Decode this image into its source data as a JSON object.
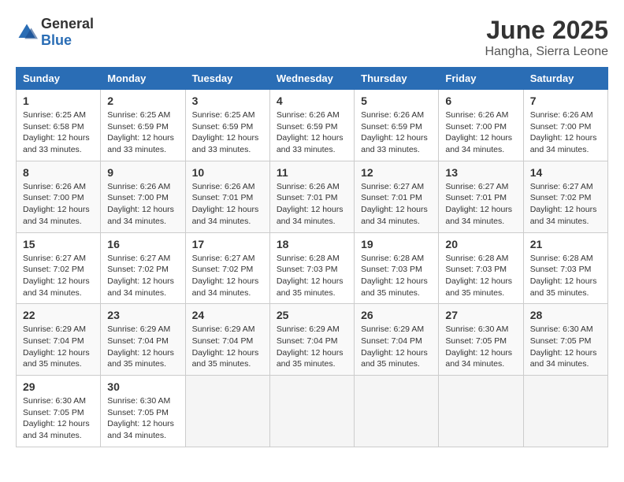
{
  "logo": {
    "general": "General",
    "blue": "Blue"
  },
  "title": "June 2025",
  "location": "Hangha, Sierra Leone",
  "days_of_week": [
    "Sunday",
    "Monday",
    "Tuesday",
    "Wednesday",
    "Thursday",
    "Friday",
    "Saturday"
  ],
  "weeks": [
    [
      {
        "day": "1",
        "sunrise": "6:25 AM",
        "sunset": "6:58 PM",
        "daylight": "12 hours and 33 minutes."
      },
      {
        "day": "2",
        "sunrise": "6:25 AM",
        "sunset": "6:59 PM",
        "daylight": "12 hours and 33 minutes."
      },
      {
        "day": "3",
        "sunrise": "6:25 AM",
        "sunset": "6:59 PM",
        "daylight": "12 hours and 33 minutes."
      },
      {
        "day": "4",
        "sunrise": "6:26 AM",
        "sunset": "6:59 PM",
        "daylight": "12 hours and 33 minutes."
      },
      {
        "day": "5",
        "sunrise": "6:26 AM",
        "sunset": "6:59 PM",
        "daylight": "12 hours and 33 minutes."
      },
      {
        "day": "6",
        "sunrise": "6:26 AM",
        "sunset": "7:00 PM",
        "daylight": "12 hours and 34 minutes."
      },
      {
        "day": "7",
        "sunrise": "6:26 AM",
        "sunset": "7:00 PM",
        "daylight": "12 hours and 34 minutes."
      }
    ],
    [
      {
        "day": "8",
        "sunrise": "6:26 AM",
        "sunset": "7:00 PM",
        "daylight": "12 hours and 34 minutes."
      },
      {
        "day": "9",
        "sunrise": "6:26 AM",
        "sunset": "7:00 PM",
        "daylight": "12 hours and 34 minutes."
      },
      {
        "day": "10",
        "sunrise": "6:26 AM",
        "sunset": "7:01 PM",
        "daylight": "12 hours and 34 minutes."
      },
      {
        "day": "11",
        "sunrise": "6:26 AM",
        "sunset": "7:01 PM",
        "daylight": "12 hours and 34 minutes."
      },
      {
        "day": "12",
        "sunrise": "6:27 AM",
        "sunset": "7:01 PM",
        "daylight": "12 hours and 34 minutes."
      },
      {
        "day": "13",
        "sunrise": "6:27 AM",
        "sunset": "7:01 PM",
        "daylight": "12 hours and 34 minutes."
      },
      {
        "day": "14",
        "sunrise": "6:27 AM",
        "sunset": "7:02 PM",
        "daylight": "12 hours and 34 minutes."
      }
    ],
    [
      {
        "day": "15",
        "sunrise": "6:27 AM",
        "sunset": "7:02 PM",
        "daylight": "12 hours and 34 minutes."
      },
      {
        "day": "16",
        "sunrise": "6:27 AM",
        "sunset": "7:02 PM",
        "daylight": "12 hours and 34 minutes."
      },
      {
        "day": "17",
        "sunrise": "6:27 AM",
        "sunset": "7:02 PM",
        "daylight": "12 hours and 34 minutes."
      },
      {
        "day": "18",
        "sunrise": "6:28 AM",
        "sunset": "7:03 PM",
        "daylight": "12 hours and 35 minutes."
      },
      {
        "day": "19",
        "sunrise": "6:28 AM",
        "sunset": "7:03 PM",
        "daylight": "12 hours and 35 minutes."
      },
      {
        "day": "20",
        "sunrise": "6:28 AM",
        "sunset": "7:03 PM",
        "daylight": "12 hours and 35 minutes."
      },
      {
        "day": "21",
        "sunrise": "6:28 AM",
        "sunset": "7:03 PM",
        "daylight": "12 hours and 35 minutes."
      }
    ],
    [
      {
        "day": "22",
        "sunrise": "6:29 AM",
        "sunset": "7:04 PM",
        "daylight": "12 hours and 35 minutes."
      },
      {
        "day": "23",
        "sunrise": "6:29 AM",
        "sunset": "7:04 PM",
        "daylight": "12 hours and 35 minutes."
      },
      {
        "day": "24",
        "sunrise": "6:29 AM",
        "sunset": "7:04 PM",
        "daylight": "12 hours and 35 minutes."
      },
      {
        "day": "25",
        "sunrise": "6:29 AM",
        "sunset": "7:04 PM",
        "daylight": "12 hours and 35 minutes."
      },
      {
        "day": "26",
        "sunrise": "6:29 AM",
        "sunset": "7:04 PM",
        "daylight": "12 hours and 35 minutes."
      },
      {
        "day": "27",
        "sunrise": "6:30 AM",
        "sunset": "7:05 PM",
        "daylight": "12 hours and 34 minutes."
      },
      {
        "day": "28",
        "sunrise": "6:30 AM",
        "sunset": "7:05 PM",
        "daylight": "12 hours and 34 minutes."
      }
    ],
    [
      {
        "day": "29",
        "sunrise": "6:30 AM",
        "sunset": "7:05 PM",
        "daylight": "12 hours and 34 minutes."
      },
      {
        "day": "30",
        "sunrise": "6:30 AM",
        "sunset": "7:05 PM",
        "daylight": "12 hours and 34 minutes."
      },
      null,
      null,
      null,
      null,
      null
    ]
  ],
  "labels": {
    "sunrise": "Sunrise:",
    "sunset": "Sunset:",
    "daylight": "Daylight:"
  }
}
